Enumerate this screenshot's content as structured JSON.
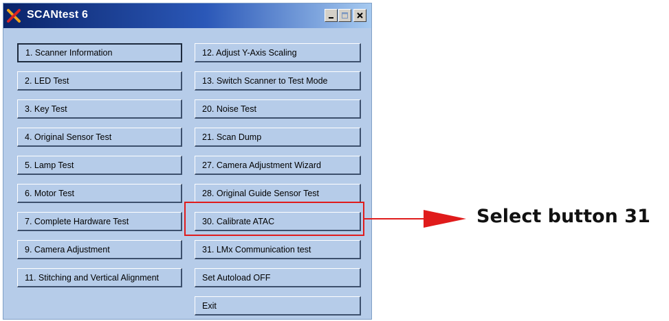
{
  "window": {
    "title": "SCANtest 6",
    "controls": {
      "minimize": "minimize",
      "maximize": "maximize",
      "close": "close"
    }
  },
  "buttons_left": [
    "1. Scanner Information",
    "2. LED Test",
    "3. Key Test",
    "4. Original Sensor Test",
    "5. Lamp Test",
    "6. Motor Test",
    "7. Complete Hardware Test",
    "9. Camera Adjustment",
    "11. Stitching and Vertical Alignment"
  ],
  "buttons_right": [
    "12. Adjust Y-Axis Scaling",
    "13. Switch Scanner to Test Mode",
    "20. Noise Test",
    "21. Scan Dump",
    "27. Camera Adjustment Wizard",
    "28. Original Guide Sensor Test",
    "30. Calibrate ATAC",
    "31. LMx Communication test",
    "Set Autoload OFF",
    "Exit"
  ],
  "annotation": {
    "callout_text": "Select button 31",
    "color": "#e01b1b"
  },
  "colors": {
    "window_bg": "#b6cce9",
    "title_gradient_start": "#0a246a",
    "title_gradient_end": "#a6caf0"
  },
  "icons": {
    "app": "scantest-x-icon",
    "minimize": "minimize-icon",
    "maximize": "maximize-icon",
    "close": "close-icon"
  }
}
